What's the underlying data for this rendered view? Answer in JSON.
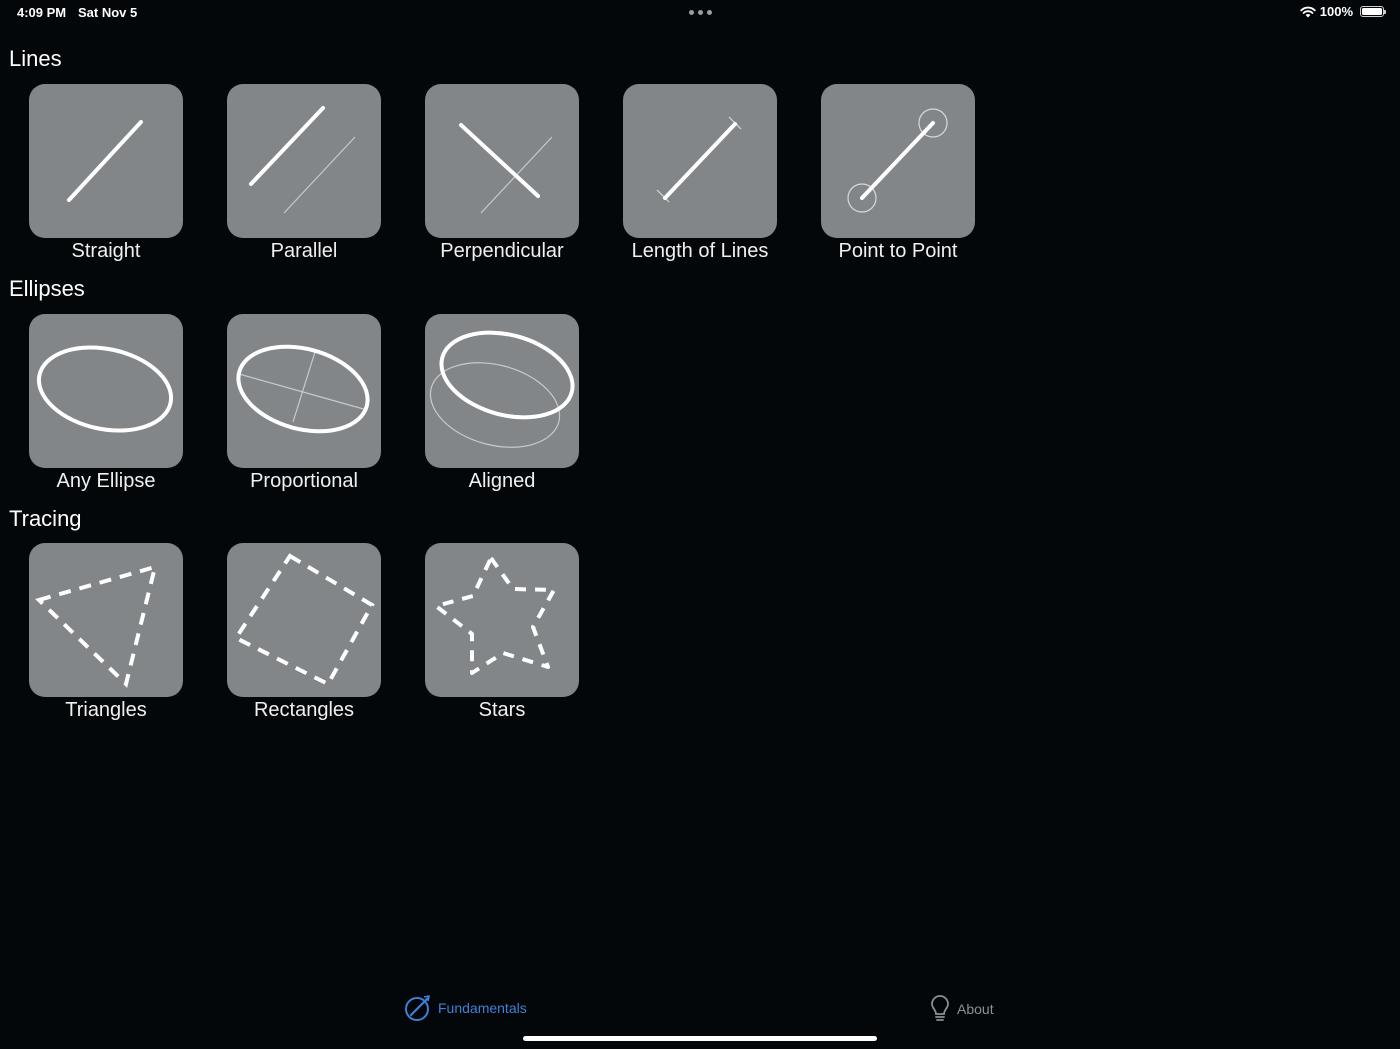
{
  "status_bar": {
    "time": "4:09 PM",
    "date": "Sat Nov 5",
    "battery": "100%"
  },
  "sections": [
    {
      "title": "Lines",
      "items": [
        {
          "label": "Straight"
        },
        {
          "label": "Parallel"
        },
        {
          "label": "Perpendicular"
        },
        {
          "label": "Length of Lines"
        },
        {
          "label": "Point to Point"
        }
      ]
    },
    {
      "title": "Ellipses",
      "items": [
        {
          "label": "Any Ellipse"
        },
        {
          "label": "Proportional"
        },
        {
          "label": "Aligned"
        }
      ]
    },
    {
      "title": "Tracing",
      "items": [
        {
          "label": "Triangles"
        },
        {
          "label": "Rectangles"
        },
        {
          "label": "Stars"
        }
      ]
    }
  ],
  "tab_bar": {
    "fundamentals": "Fundamentals",
    "about": "About"
  },
  "colors": {
    "background": "#040709",
    "tile": "#828688",
    "accent": "#3f7fd8",
    "inactive_tab": "#8e8f93"
  }
}
